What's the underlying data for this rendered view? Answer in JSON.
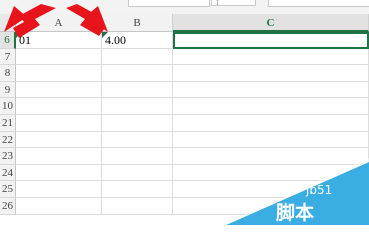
{
  "formula_bar": {
    "fx_fragment": "f"
  },
  "columns": [
    {
      "label": "A",
      "active": false
    },
    {
      "label": "B",
      "active": false
    },
    {
      "label": "C",
      "active": true
    }
  ],
  "rows": [
    {
      "label": "6",
      "a": "01",
      "b": "4.00",
      "c": "",
      "active": true
    },
    {
      "label": "7",
      "a": "",
      "b": "",
      "c": ""
    },
    {
      "label": "8",
      "a": "",
      "b": "",
      "c": ""
    },
    {
      "label": "9",
      "a": "",
      "b": "",
      "c": ""
    },
    {
      "label": "10",
      "a": "",
      "b": "",
      "c": ""
    },
    {
      "label": "21",
      "a": "",
      "b": "",
      "c": ""
    },
    {
      "label": "22",
      "a": "",
      "b": "",
      "c": ""
    },
    {
      "label": "23",
      "a": "",
      "b": "",
      "c": ""
    },
    {
      "label": "24",
      "a": "",
      "b": "",
      "c": ""
    },
    {
      "label": "25",
      "a": "",
      "b": "",
      "c": ""
    },
    {
      "label": "26",
      "a": "",
      "b": "",
      "c": ""
    }
  ],
  "watermark": {
    "site": "jb51",
    "brand_text": "脚本"
  },
  "colors": {
    "accent": "#217346",
    "arrow": "#e8141b",
    "banner": "#3aaee2"
  }
}
